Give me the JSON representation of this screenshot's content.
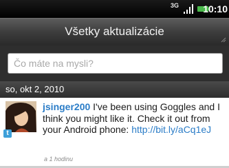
{
  "status": {
    "network": "3G",
    "time": "10:10"
  },
  "header": {
    "title": "Všetky aktualizácie"
  },
  "compose": {
    "placeholder": "Čo máte na mysli?"
  },
  "feed": {
    "date": "so, okt 2, 2010",
    "items": [
      {
        "user": "jsinger200",
        "text": " I've been using Goggles and I think you might like it. Check it out from your Android phone: ",
        "link": "http://bit.ly/aCq1eJ",
        "time": "a 1 hodinu",
        "source_icon": "twitter-icon"
      }
    ]
  },
  "colors": {
    "link": "#2a7cc7",
    "title_bar": "#3d3d3d"
  }
}
